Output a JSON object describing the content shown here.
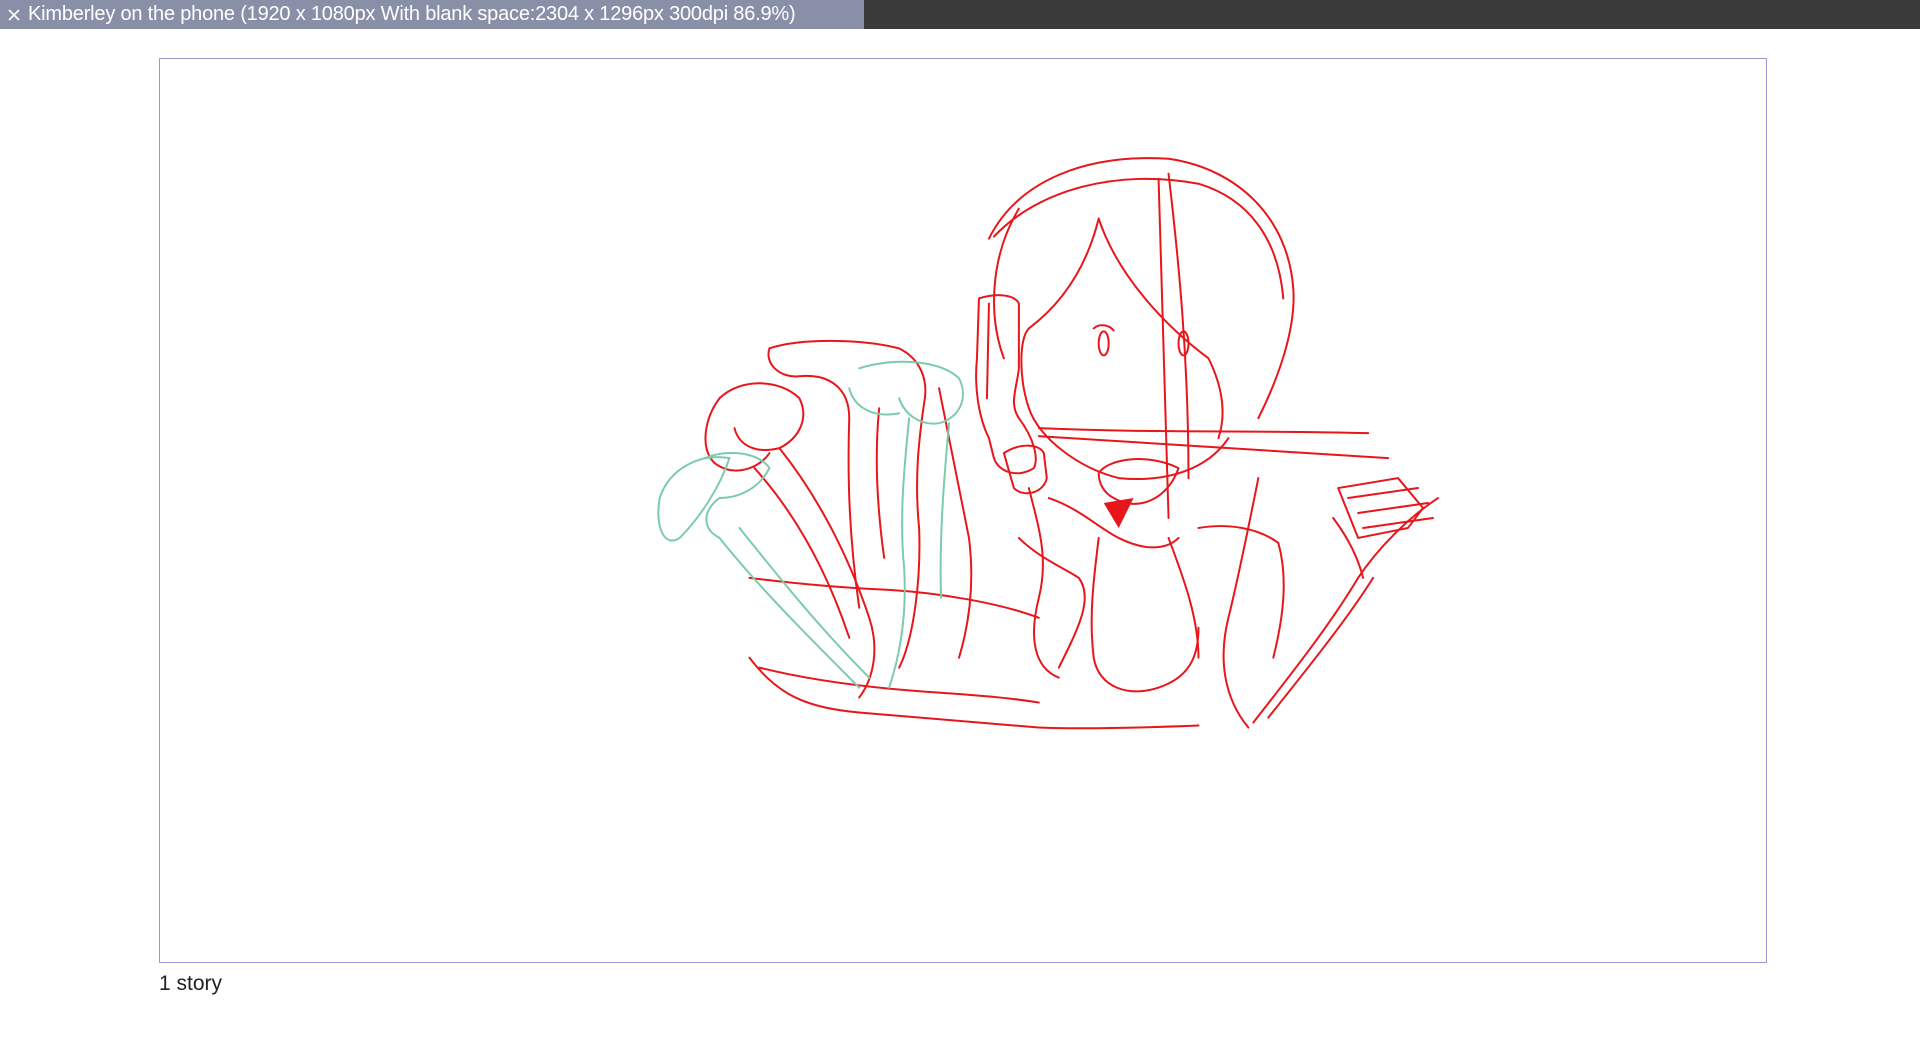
{
  "tab": {
    "title": "Kimberley on the phone (1920 x 1080px With blank space:2304 x 1296px 300dpi 86.9%)",
    "close_icon": "close-icon"
  },
  "canvas": {
    "caption": "1 story"
  },
  "colors": {
    "topbar": "#3a3a3a",
    "active_tab": "#8a8fa8",
    "canvas_border": "#9c98cf",
    "sketch_red": "#e8161b",
    "sketch_green": "#7ccbac"
  }
}
